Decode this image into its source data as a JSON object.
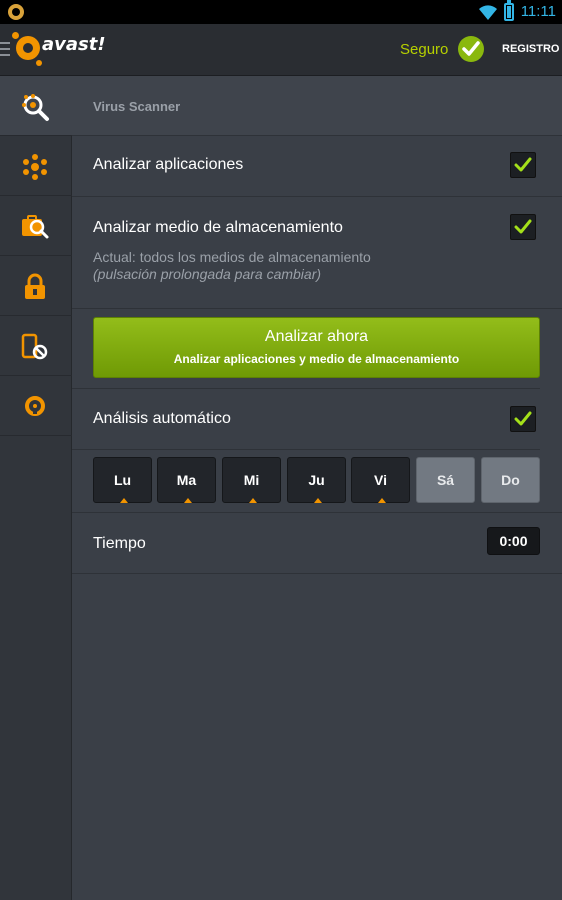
{
  "status_bar": {
    "time": "11:11"
  },
  "header": {
    "brand": "avast!",
    "status": "Seguro",
    "register_label": "REGISTRO"
  },
  "sidebar": {
    "items": [
      {
        "icon": "virus-scanner-icon",
        "active": true
      },
      {
        "icon": "network-icon",
        "active": false
      },
      {
        "icon": "privacy-advisor-icon",
        "active": false
      },
      {
        "icon": "app-lock-icon",
        "active": false
      },
      {
        "icon": "call-filter-icon",
        "active": false
      },
      {
        "icon": "anti-theft-icon",
        "active": false
      }
    ]
  },
  "main": {
    "section_title": "Virus Scanner",
    "scan_apps": {
      "label": "Analizar aplicaciones",
      "checked": true
    },
    "scan_storage": {
      "label": "Analizar medio de almacenamiento",
      "detail": "Actual: todos los medios de almacenamiento",
      "hint": "(pulsación prolongada para cambiar)",
      "checked": true
    },
    "scan_button": {
      "label": "Analizar ahora",
      "sublabel": "Analizar aplicaciones y medio de almacenamiento"
    },
    "auto_scan": {
      "label": "Análisis automático",
      "checked": true
    },
    "days": [
      {
        "label": "Lu",
        "selected": true
      },
      {
        "label": "Ma",
        "selected": true
      },
      {
        "label": "Mi",
        "selected": true
      },
      {
        "label": "Ju",
        "selected": true
      },
      {
        "label": "Vi",
        "selected": true
      },
      {
        "label": "Sá",
        "selected": false
      },
      {
        "label": "Do",
        "selected": false
      }
    ],
    "time": {
      "label": "Tiempo",
      "value": "0:00"
    }
  },
  "colors": {
    "accent_orange": "#f29400",
    "accent_green": "#8ab80e",
    "status_text": "#b6d000",
    "check_mark": "#a4e01a"
  }
}
